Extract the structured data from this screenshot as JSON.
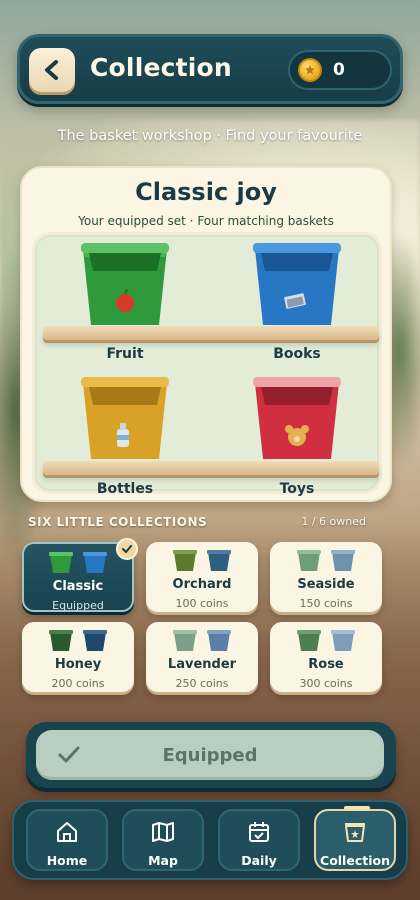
{
  "header": {
    "title": "Collection",
    "coins": "0"
  },
  "subtitle": "The basket workshop · Find your favourite",
  "showcase": {
    "title": "Classic joy",
    "description": "Your equipped set · Four matching baskets",
    "baskets": [
      {
        "label": "Fruit",
        "color": "#2e9a3b",
        "icon": "apple-icon"
      },
      {
        "label": "Books",
        "color": "#2877c4",
        "icon": "book-icon"
      },
      {
        "label": "Bottles",
        "color": "#d9a227",
        "icon": "bottle-icon"
      },
      {
        "label": "Toys",
        "color": "#cf2f40",
        "icon": "teddy-bear-icon"
      }
    ]
  },
  "collections": {
    "title": "SIX LITTLE COLLECTIONS",
    "owned": "1 / 6 owned",
    "items": [
      {
        "name": "Classic",
        "price": "Equipped",
        "left": "#2e9a3b",
        "right": "#2877c4"
      },
      {
        "name": "Orchard",
        "price": "100 coins",
        "left": "#5b7a2c",
        "right": "#2f5e82"
      },
      {
        "name": "Seaside",
        "price": "150 coins",
        "left": "#6f9d76",
        "right": "#6c93ab"
      },
      {
        "name": "Honey",
        "price": "200 coins",
        "left": "#2b5a2e",
        "right": "#1f4868"
      },
      {
        "name": "Lavender",
        "price": "250 coins",
        "left": "#7d9e87",
        "right": "#5a7fa8"
      },
      {
        "name": "Rose",
        "price": "300 coins",
        "left": "#4f7f4f",
        "right": "#7f9db8"
      }
    ]
  },
  "equip_button": {
    "label": "Equipped"
  },
  "nav": [
    {
      "label": "Home",
      "icon": "home-icon"
    },
    {
      "label": "Map",
      "icon": "map-icon"
    },
    {
      "label": "Daily",
      "icon": "calendar-icon"
    },
    {
      "label": "Collection",
      "icon": "basket-icon"
    }
  ]
}
